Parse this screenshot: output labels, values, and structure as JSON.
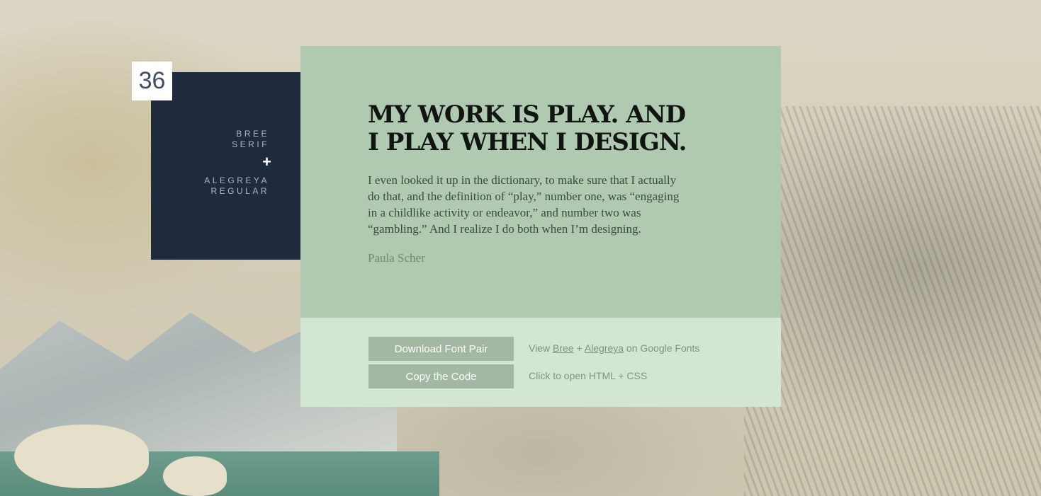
{
  "pair": {
    "number": "36",
    "heading_font_line1": "BREE",
    "heading_font_line2": "SERIF",
    "plus_symbol": "+",
    "body_font_line1": "ALEGREYA",
    "body_font_line2": "REGULAR"
  },
  "quote": {
    "headline": "MY WORK IS PLAY. AND I PLAY WHEN I DESIGN.",
    "body": "I even looked it up in the dictionary, to make sure that I actually do that, and the definition of “play,” number one, was “engaging in a childlike activity or endeavor,” and number two was “gambling.” And I realize I do both when I’m designing.",
    "author": "Paula Scher"
  },
  "actions": {
    "download_label": "Download Font Pair",
    "copy_label": "Copy the Code",
    "view_prefix": "View",
    "link_bree": "Bree",
    "plus_text": "+",
    "link_alegreya": "Alegreya",
    "view_suffix": "on Google Fonts",
    "code_hint": "Click to open HTML + CSS"
  },
  "colors": {
    "card_background": "#b0cab1",
    "footer_background": "#d3e5d3",
    "sidebar_background": "#1f2a3d",
    "button_background": "#a2b8a3"
  }
}
